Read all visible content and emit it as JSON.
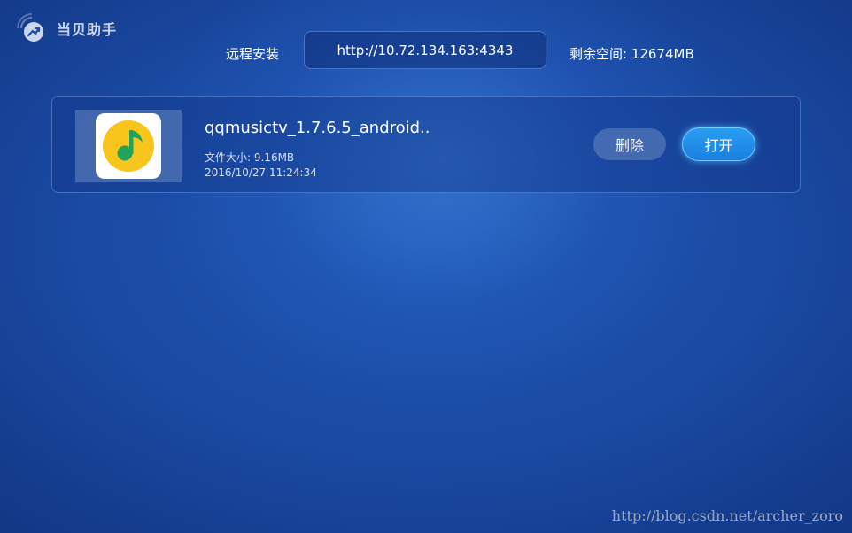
{
  "header": {
    "app_name": "当贝助手",
    "remote_install_label": "远程安装",
    "address": "http://10.72.134.163:4343",
    "remaining_space": "剩余空间: 12674MB"
  },
  "files": [
    {
      "name": "qqmusictv_1.7.6.5_android..",
      "size": "文件大小: 9.16MB",
      "date": "2016/10/27 11:24:34",
      "delete_label": "删除",
      "open_label": "打开"
    }
  ],
  "watermark": "http://blog.csdn.net/archer_zoro",
  "colors": {
    "background": "#1a4aa3",
    "open_button": "#1a80e0",
    "icon_yellow": "#f8c51c",
    "icon_green": "#21a35a"
  },
  "icons": {
    "logo": "signal-arrow-icon",
    "app": "music-note-icon"
  }
}
